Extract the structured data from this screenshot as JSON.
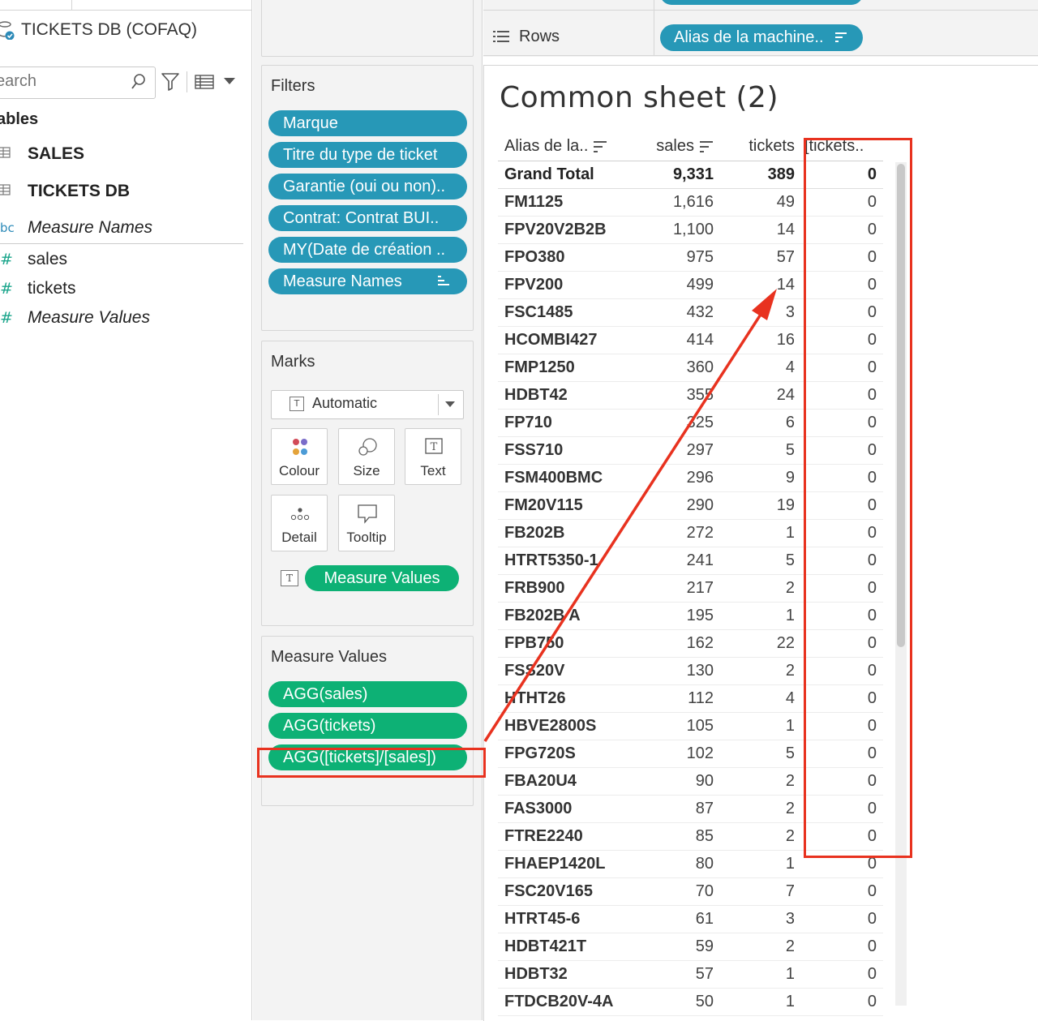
{
  "datasource": {
    "name": "TICKETS DB (COFAQ)"
  },
  "search": {
    "placeholder": "earch"
  },
  "data_pane": {
    "section_title": "ables",
    "tables": [
      {
        "label": "SALES"
      },
      {
        "label": "TICKETS DB"
      }
    ],
    "fields": [
      {
        "type_icon": "bc",
        "label": "Measure Names"
      },
      {
        "type_icon": "#",
        "label": "sales"
      },
      {
        "type_icon": "#",
        "label": "tickets"
      },
      {
        "type_icon": "#",
        "label": "Measure Values"
      }
    ]
  },
  "rows_shelf": {
    "label": "Rows",
    "pill": "Alias de la machine.."
  },
  "filters": {
    "title": "Filters",
    "items": [
      "Marque",
      "Titre du type de ticket",
      "Garantie (oui ou non)..",
      "Contrat: Contrat BUI..",
      "MY(Date de création ..",
      "Measure Names"
    ]
  },
  "marks": {
    "title": "Marks",
    "type": "Automatic",
    "buttons": [
      "Colour",
      "Size",
      "Text",
      "Detail",
      "Tooltip"
    ],
    "text_pill": "Measure Values"
  },
  "measure_values": {
    "title": "Measure Values",
    "items": [
      "AGG(sales)",
      "AGG(tickets)",
      "AGG([tickets]/[sales])"
    ]
  },
  "view": {
    "title": "Common sheet (2)",
    "columns": [
      "Alias de la..",
      "sales",
      "tickets",
      "[tickets.."
    ],
    "grand_total": {
      "label": "Grand Total",
      "sales": "9,331",
      "tickets": "389",
      "ratio": "0"
    },
    "rows": [
      {
        "name": "FM1125",
        "sales": "1,616",
        "tickets": "49",
        "ratio": "0"
      },
      {
        "name": "FPV20V2B2B",
        "sales": "1,100",
        "tickets": "14",
        "ratio": "0"
      },
      {
        "name": "FPO380",
        "sales": "975",
        "tickets": "57",
        "ratio": "0"
      },
      {
        "name": "FPV200",
        "sales": "499",
        "tickets": "14",
        "ratio": "0"
      },
      {
        "name": "FSC1485",
        "sales": "432",
        "tickets": "3",
        "ratio": "0"
      },
      {
        "name": "HCOMBI427",
        "sales": "414",
        "tickets": "16",
        "ratio": "0"
      },
      {
        "name": "FMP1250",
        "sales": "360",
        "tickets": "4",
        "ratio": "0"
      },
      {
        "name": "HDBT42",
        "sales": "355",
        "tickets": "24",
        "ratio": "0"
      },
      {
        "name": "FP710",
        "sales": "325",
        "tickets": "6",
        "ratio": "0"
      },
      {
        "name": "FSS710",
        "sales": "297",
        "tickets": "5",
        "ratio": "0"
      },
      {
        "name": "FSM400BMC",
        "sales": "296",
        "tickets": "9",
        "ratio": "0"
      },
      {
        "name": "FM20V115",
        "sales": "290",
        "tickets": "19",
        "ratio": "0"
      },
      {
        "name": "FB202B",
        "sales": "272",
        "tickets": "1",
        "ratio": "0"
      },
      {
        "name": "HTRT5350-1",
        "sales": "241",
        "tickets": "5",
        "ratio": "0"
      },
      {
        "name": "FRB900",
        "sales": "217",
        "tickets": "2",
        "ratio": "0"
      },
      {
        "name": "FB202B A",
        "sales": "195",
        "tickets": "1",
        "ratio": "0"
      },
      {
        "name": "FPB750",
        "sales": "162",
        "tickets": "22",
        "ratio": "0"
      },
      {
        "name": "FSS20V",
        "sales": "130",
        "tickets": "2",
        "ratio": "0"
      },
      {
        "name": "HTHT26",
        "sales": "112",
        "tickets": "4",
        "ratio": "0"
      },
      {
        "name": "HBVE2800S",
        "sales": "105",
        "tickets": "1",
        "ratio": "0"
      },
      {
        "name": "FPG720S",
        "sales": "102",
        "tickets": "5",
        "ratio": "0"
      },
      {
        "name": "FBA20U4",
        "sales": "90",
        "tickets": "2",
        "ratio": "0"
      },
      {
        "name": "FAS3000",
        "sales": "87",
        "tickets": "2",
        "ratio": "0"
      },
      {
        "name": "FTRE2240",
        "sales": "85",
        "tickets": "2",
        "ratio": "0"
      },
      {
        "name": "FHAEP1420L",
        "sales": "80",
        "tickets": "1",
        "ratio": "0"
      },
      {
        "name": "FSC20V165",
        "sales": "70",
        "tickets": "7",
        "ratio": "0"
      },
      {
        "name": "HTRT45-6",
        "sales": "61",
        "tickets": "3",
        "ratio": "0"
      },
      {
        "name": "HDBT421T",
        "sales": "59",
        "tickets": "2",
        "ratio": "0"
      },
      {
        "name": "HDBT32",
        "sales": "57",
        "tickets": "1",
        "ratio": "0"
      },
      {
        "name": "FTDCB20V-4A",
        "sales": "50",
        "tickets": "1",
        "ratio": "0"
      }
    ]
  },
  "colors": {
    "dimension_pill": "#2798b7",
    "measure_pill": "#0db175",
    "annotation": "#e8321f"
  }
}
